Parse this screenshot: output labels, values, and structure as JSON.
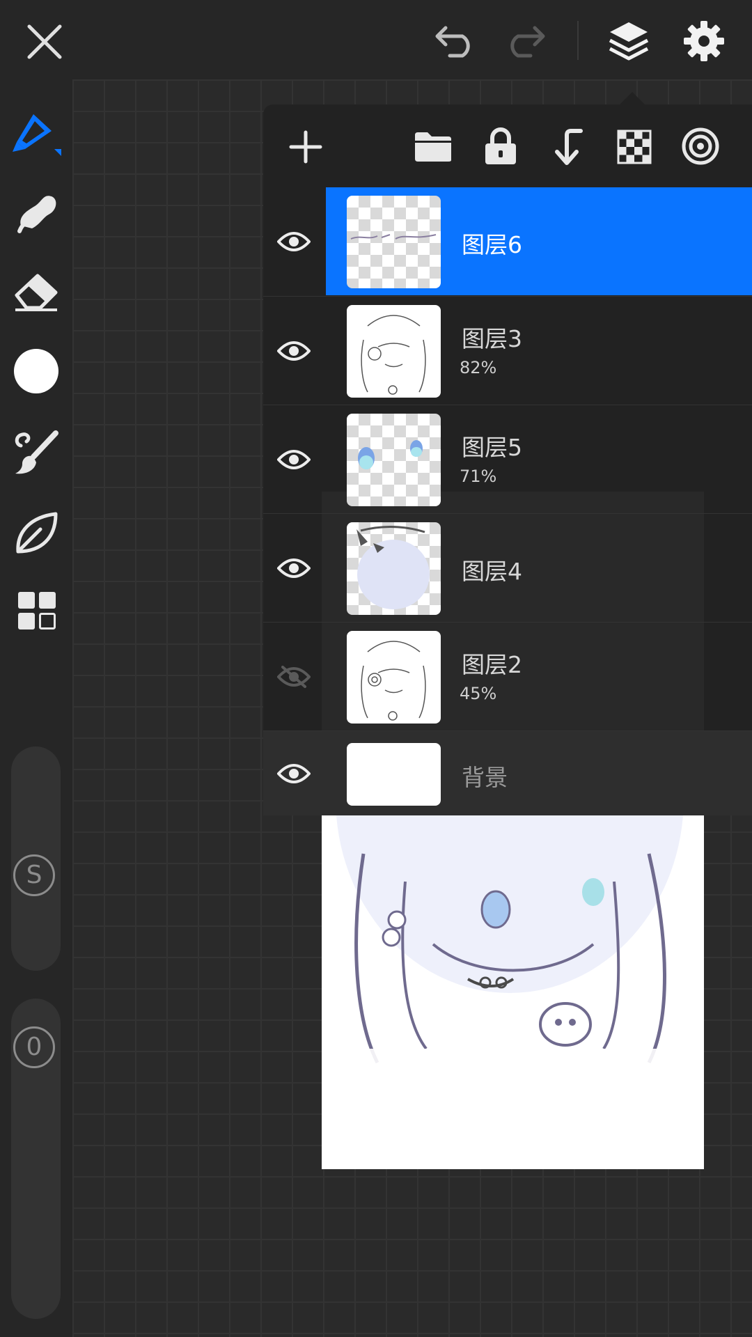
{
  "top_bar": {
    "close_icon": "close-icon",
    "undo_icon": "undo-icon",
    "redo_icon": "redo-icon",
    "layers_icon": "layers-icon",
    "settings_icon": "settings-icon"
  },
  "tools": [
    {
      "name": "pencil",
      "icon": "pencil-icon",
      "active": true
    },
    {
      "name": "smudge",
      "icon": "smudge-icon"
    },
    {
      "name": "eraser",
      "icon": "eraser-icon"
    },
    {
      "name": "color",
      "icon": "color-swatch",
      "color": "#ffffff"
    },
    {
      "name": "brush",
      "icon": "brush-icon"
    },
    {
      "name": "leaf",
      "icon": "leaf-icon"
    },
    {
      "name": "gallery",
      "icon": "grid-icon"
    }
  ],
  "sliders": {
    "size_label": "S",
    "opacity_label": "0"
  },
  "layers_toolbar": [
    "add-icon",
    "folder-icon",
    "lock-icon",
    "merge-down-icon",
    "transparency-icon",
    "target-icon"
  ],
  "layers": [
    {
      "name": "图层6",
      "opacity": "",
      "selected": true,
      "visible": true,
      "alpha_lock": false
    },
    {
      "name": "图层3",
      "opacity": "82%",
      "selected": false,
      "visible": true,
      "alpha_lock": true
    },
    {
      "name": "图层5",
      "opacity": "71%",
      "selected": false,
      "visible": true,
      "alpha_lock": true
    },
    {
      "name": "图层4",
      "opacity": "",
      "selected": false,
      "visible": true,
      "alpha_lock": false
    },
    {
      "name": "图层2",
      "opacity": "45%",
      "selected": false,
      "visible": false,
      "alpha_lock": true
    },
    {
      "name": "背景",
      "opacity": "",
      "selected": false,
      "visible": true,
      "alpha_lock": false
    }
  ],
  "colors": {
    "accent": "#0a74ff",
    "background": "#262626",
    "panel": "#222222"
  }
}
